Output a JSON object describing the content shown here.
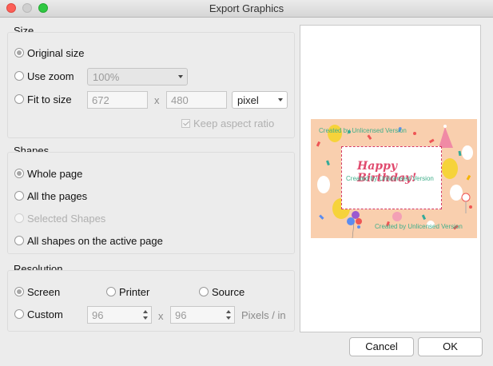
{
  "window": {
    "title": "Export Graphics"
  },
  "size": {
    "label": "Size",
    "original_label": "Original size",
    "zoom_label": "Use zoom",
    "zoom_value": "100%",
    "fit_label": "Fit to size",
    "width_value": "672",
    "height_value": "480",
    "times": "x",
    "unit_value": "pixel",
    "aspect_label": "Keep aspect ratio"
  },
  "shapes": {
    "label": "Shapes",
    "whole_label": "Whole page",
    "all_pages_label": "All the pages",
    "selected_label": "Selected Shapes",
    "active_label": "All shapes on the active page"
  },
  "resolution": {
    "label": "Resolution",
    "screen_label": "Screen",
    "printer_label": "Printer",
    "source_label": "Source",
    "custom_label": "Custom",
    "x_value": "96",
    "y_value": "96",
    "times": "x",
    "unit": "Pixels / in"
  },
  "preview": {
    "watermark": "Created by Unlicensed Version",
    "happy_text": "Happy",
    "birthday_text": "Birthday!",
    "card_color": "#f9cfae"
  },
  "buttons": {
    "cancel_label": "Cancel",
    "ok_label": "OK"
  }
}
